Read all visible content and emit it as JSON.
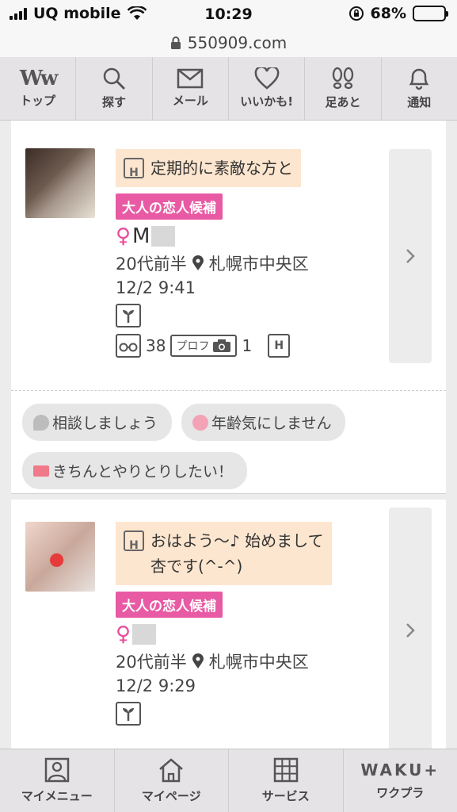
{
  "status_bar": {
    "carrier": "UQ mobile",
    "time": "10:29",
    "battery": "68%",
    "battery_level": 0.68
  },
  "url_bar": {
    "url": "550909.com"
  },
  "top_nav": [
    {
      "label": "トップ",
      "icon": "ww-logo-icon"
    },
    {
      "label": "探す",
      "icon": "search-icon"
    },
    {
      "label": "メール",
      "icon": "mail-icon"
    },
    {
      "label": "いいかも!",
      "icon": "heart-icon"
    },
    {
      "label": "足あと",
      "icon": "footprint-icon"
    },
    {
      "label": "通知",
      "icon": "bell-icon"
    }
  ],
  "profiles": [
    {
      "message": "定期的に素敵な方と",
      "badge": "大人の恋人候補",
      "gender_symbol": "♀",
      "name_visible": "M",
      "age": "20代前半",
      "location": "札幌市中央区",
      "time": "12/2 9:41",
      "views": "38",
      "prof_label": "プロフ",
      "photo_count": "1",
      "tags": [
        {
          "label": "相談しましょう",
          "emoji_color": "#bcbcbc"
        },
        {
          "label": "年齢気にしません",
          "emoji_color": "#f3a3b5"
        },
        {
          "label": "きちんとやりとりしたい！",
          "emoji_color": "#f07a8a"
        }
      ]
    },
    {
      "message_line1": "おはよう～♪ 始めまして",
      "message_line2": "杏です(^-^)",
      "badge": "大人の恋人候補",
      "gender_symbol": "♀",
      "age": "20代前半",
      "location": "札幌市中央区",
      "time": "12/2 9:29"
    }
  ],
  "bottom_nav": [
    {
      "label": "マイメニュー",
      "icon": "person-card-icon"
    },
    {
      "label": "マイページ",
      "icon": "home-icon"
    },
    {
      "label": "サービス",
      "icon": "grid-icon"
    },
    {
      "label": "ワクプラ",
      "logo": "WAKU+"
    }
  ],
  "colors": {
    "accent_pink": "#e85aa3",
    "message_bg": "#fde6cf",
    "nav_bg": "#e6e3e6"
  }
}
